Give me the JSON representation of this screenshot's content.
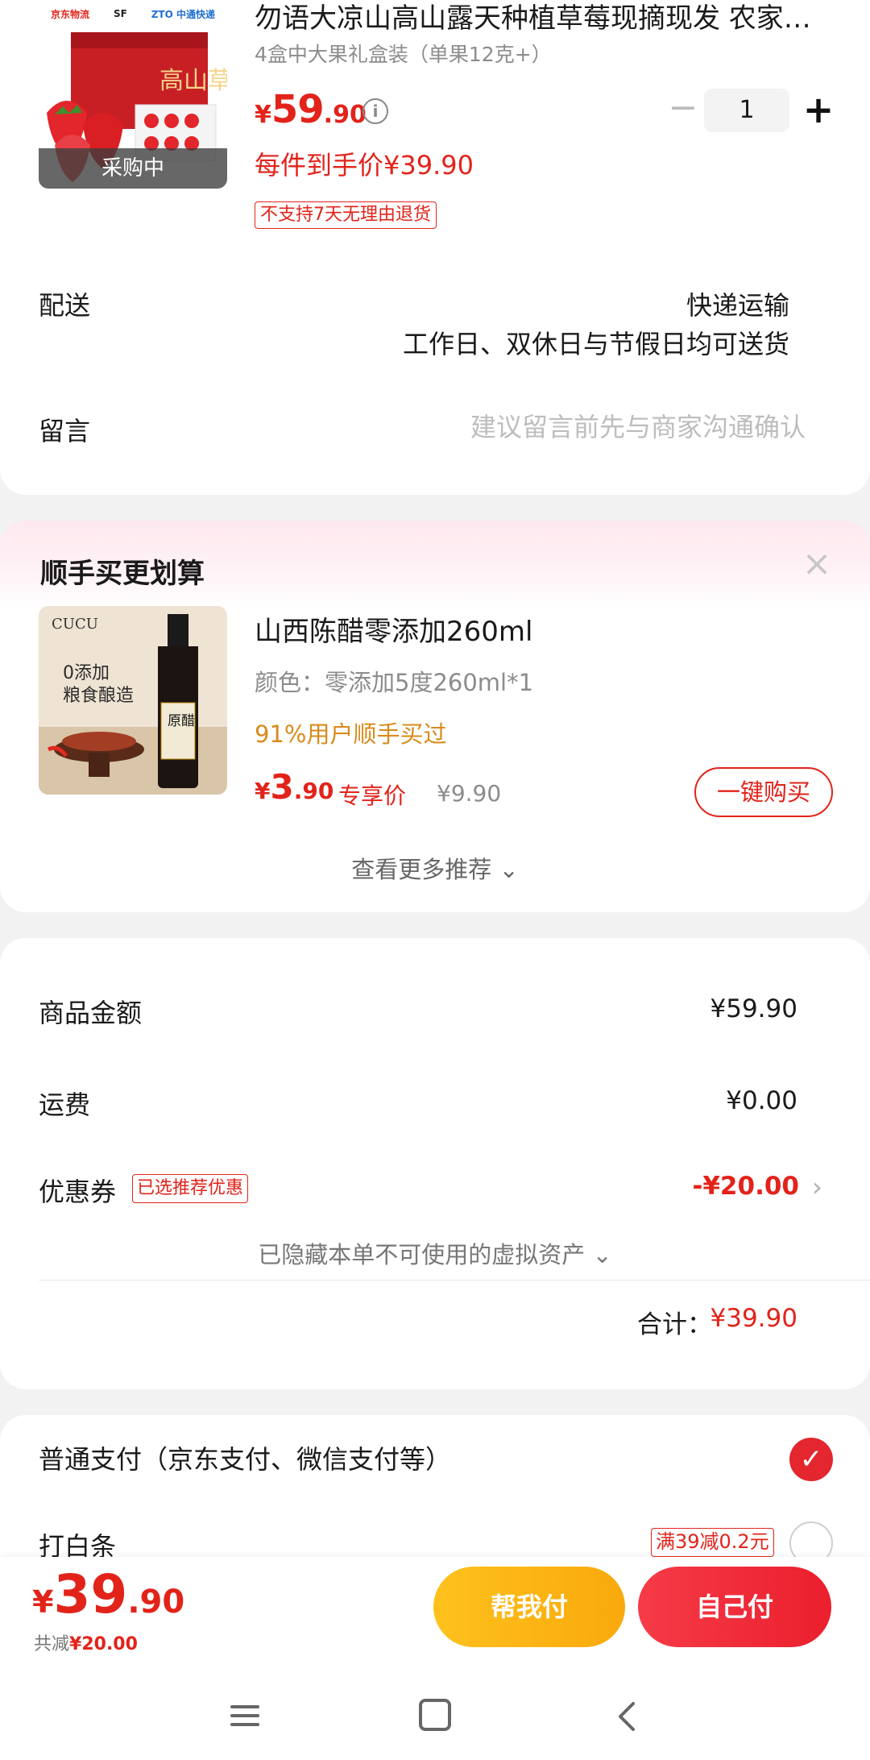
{
  "product": {
    "thumb_logos": [
      "京东物流",
      "SF",
      "ZTO 中通快递"
    ],
    "thumb_box_text": "高山草莓",
    "badge": "采购中",
    "title": "勿语大凉山高山露天种植草莓现摘现发 农家…",
    "spec": "4盒中大果礼盒装（单果12克+）",
    "price_yen": "¥",
    "price_int": "59",
    "price_dec": ".90",
    "info_icon": "i",
    "qty_minus": "−",
    "qty": "1",
    "qty_plus": "+",
    "arrive_price": "每件到手价¥39.90",
    "no_return_tag": "不支持7天无理由退货"
  },
  "delivery": {
    "label": "配送",
    "method": "快递运输",
    "days": "工作日、双休日与节假日均可送货"
  },
  "message": {
    "label": "留言",
    "placeholder": "建议留言前先与商家沟通确认"
  },
  "recommend": {
    "title": "顺手买更划算",
    "close": "×",
    "thumb_brand": "CUCU",
    "thumb_text1": "0添加",
    "thumb_text2": "粮食酿造",
    "thumb_label": "原醋",
    "name": "山西陈醋零添加260ml",
    "attr": "颜色：零添加5度260ml*1",
    "social": "91%用户顺手买过",
    "price_yen": "¥",
    "price_int": "3",
    "price_dec": ".90",
    "exclusive_label": "专享价",
    "orig_price": "¥9.90",
    "buy_button": "一键购买",
    "see_more": "查看更多推荐 ⌄"
  },
  "amounts": {
    "goods_label": "商品金额",
    "goods_value": "¥59.90",
    "shipping_label": "运费",
    "shipping_value": "¥0.00",
    "coupon_label": "优惠券",
    "coupon_tag": "已选推荐优惠",
    "coupon_value": "-¥20.00",
    "coupon_chevron": "›",
    "hidden_assets": "已隐藏本单不可使用的虚拟资产 ⌄",
    "total_label": "合计：",
    "total_value": "¥39.90"
  },
  "payment": {
    "option1": "普通支付（京东支付、微信支付等）",
    "check": "✓",
    "option2": "打白条",
    "baitiao_tag": "满39减0.2元"
  },
  "bottom": {
    "price_yen": "¥",
    "price_int": "39",
    "price_dec": ".90",
    "saved_label": "共减",
    "saved_value": "¥20.00",
    "help_pay": "帮我付",
    "self_pay": "自己付"
  },
  "colors": {
    "accent": "#e2231a",
    "help_pay_bg": "#fec11d",
    "self_pay_bg": "#eb1f2d",
    "social_text": "#d88b1c"
  }
}
